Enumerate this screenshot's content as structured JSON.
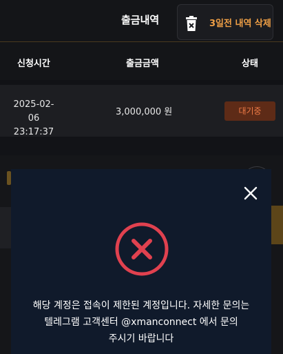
{
  "header": {
    "title": "출금내역",
    "delete_label": "3일전 내역 삭제"
  },
  "table": {
    "columns": [
      "신청시간",
      "출금금액",
      "상태"
    ],
    "rows": [
      {
        "date": "2025-02-06",
        "time": "23:17:37",
        "amount": "3,000,000 원",
        "status": "대기중"
      }
    ]
  },
  "modal": {
    "message_line1": "해당 계정은 접속이 제한된 계정입니다. 자세한 문의는",
    "message_line2": "텔레그램 고객센터 @xmanconnect 에서 문의",
    "message_line3": "주시기 바랍니다"
  },
  "icons": {
    "trash": "trash-icon",
    "close": "close-icon",
    "error": "error-circle-x-icon"
  },
  "colors": {
    "accent_orange": "#f0a046",
    "status_pending_bg": "#5e2b17",
    "status_pending_text": "#f07b47",
    "error_red": "#e0414f",
    "modal_bg": "#101a2b"
  }
}
